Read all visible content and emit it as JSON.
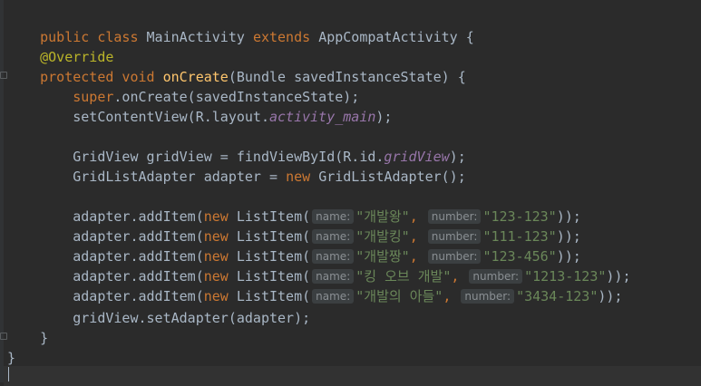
{
  "editor": {
    "language": "java",
    "colors": {
      "background": "#2b2b2b",
      "keyword": "#cc7832",
      "annotation": "#bbb529",
      "method": "#ffc66d",
      "string": "#6a8759",
      "field": "#9876aa",
      "text": "#a9b7c6"
    },
    "lines": {
      "l1": {
        "kw1": "public class ",
        "cls": "MainActivity ",
        "kw2": "extends ",
        "rest": "AppCompatActivity {"
      },
      "l3": {
        "ann": "@Override"
      },
      "l4": {
        "kw": "protected void ",
        "fn": "onCreate",
        "rest": "(Bundle savedInstanceState) {"
      },
      "l5": {
        "kw": "super",
        "rest": ".onCreate(savedInstanceState);"
      },
      "l6": {
        "pre": "setContentView(R.layout.",
        "fld": "activity_main",
        "post": ");"
      },
      "l8": {
        "pre": "GridView gridView = findViewById(R.id.",
        "fld": "gridView",
        "post": ");"
      },
      "l9": {
        "pre": "GridListAdapter adapter = ",
        "kw": "new ",
        "post": "GridListAdapter();"
      },
      "items": [
        {
          "name_hint": "name:",
          "name": "\"개발왕\"",
          "number_hint": "number:",
          "number": "\"123-123\""
        },
        {
          "name_hint": "name:",
          "name": "\"개발킹\"",
          "number_hint": "number:",
          "number": "\"111-123\""
        },
        {
          "name_hint": "name:",
          "name": "\"개발짱\"",
          "number_hint": "number:",
          "number": "\"123-456\""
        },
        {
          "name_hint": "name:",
          "name": "\"킹 오브 개발\"",
          "number_hint": "number:",
          "number": "\"1213-123\""
        },
        {
          "name_hint": "name:",
          "name": "\"개발의 아들\"",
          "number_hint": "number:",
          "number": "\"3434-123\""
        }
      ],
      "item_prefix": "adapter.addItem(",
      "item_new": "new ",
      "item_class": "ListItem(",
      "item_comma": ", ",
      "item_suffix": "));",
      "l16": {
        "text": "gridView.setAdapter(adapter);"
      },
      "l17": {
        "text": "}"
      },
      "l18": {
        "text": "}"
      }
    }
  }
}
